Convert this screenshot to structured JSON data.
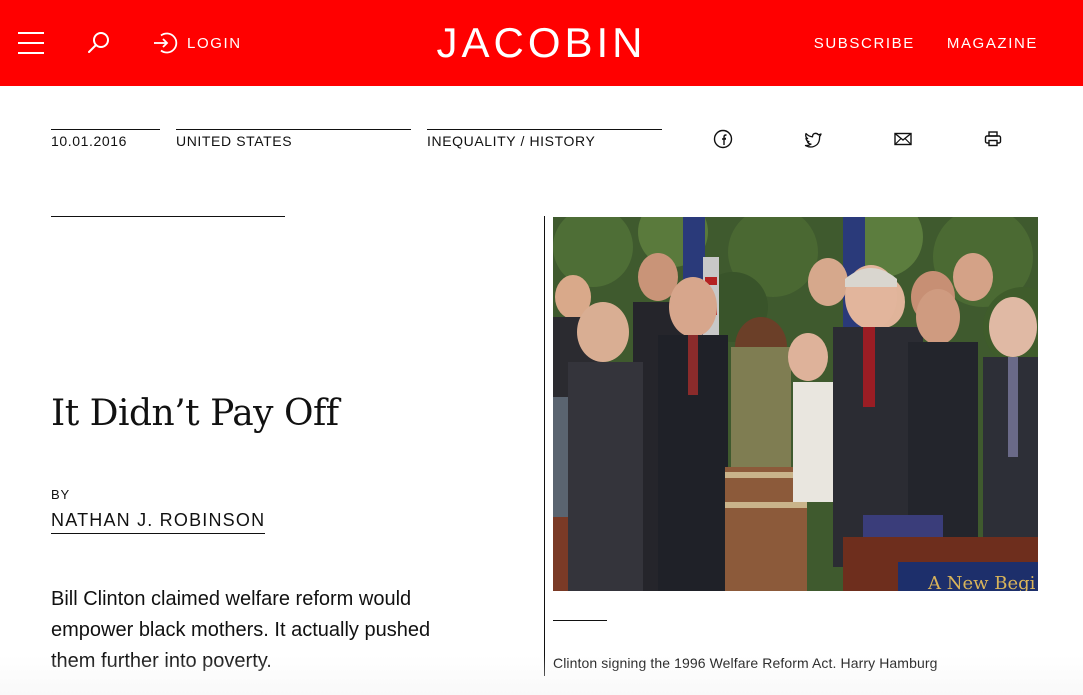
{
  "header": {
    "logo": "JACOBIN",
    "login_label": "LOGIN",
    "subscribe_label": "SUBSCRIBE",
    "magazine_label": "MAGAZINE",
    "bg_color": "#ff0000",
    "icons": [
      "menu-icon",
      "search-icon",
      "login-icon"
    ]
  },
  "meta": {
    "date": "10.01.2016",
    "region": "UNITED STATES",
    "topics": "INEQUALITY / HISTORY"
  },
  "share": {
    "icons": [
      "facebook-icon",
      "twitter-icon",
      "email-icon",
      "print-icon"
    ]
  },
  "article": {
    "title": "It Didn’t Pay Off",
    "by_label": "BY",
    "author": "NATHAN J. ROBINSON",
    "dek": "Bill Clinton claimed welfare reform would empower black mothers. It actually pushed them further into poverty."
  },
  "photo": {
    "sign_text": "A New Begi",
    "caption": "Clinton signing the 1996 Welfare Reform Act. Harry Hamburg"
  }
}
